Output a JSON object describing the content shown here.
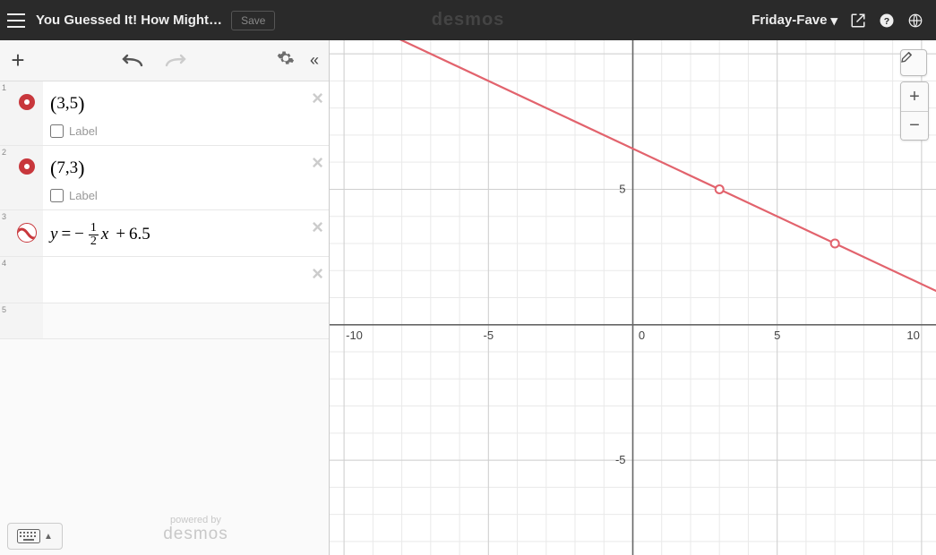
{
  "header": {
    "title": "You Guessed It! How Might…",
    "save_label": "Save",
    "brand": "desmos",
    "user": "Friday-Fave"
  },
  "toolbar": {
    "add_label": "+",
    "collapse_label": "«"
  },
  "expressions": [
    {
      "index": "1",
      "text": "(3,5)",
      "label_word": "Label",
      "type": "point"
    },
    {
      "index": "2",
      "text": "(7,3)",
      "label_word": "Label",
      "type": "point"
    },
    {
      "index": "3",
      "text": "y = − ½ x + 6.5",
      "frac_n": "1",
      "frac_d": "2",
      "const": "6.5",
      "type": "line"
    },
    {
      "index": "4",
      "text": ""
    },
    {
      "index": "5",
      "text": ""
    }
  ],
  "footer": {
    "powered_top": "powered by",
    "powered_brand": "desmos"
  },
  "graph_ticks": {
    "xneg10": "-10",
    "xneg5": "-5",
    "zero": "0",
    "x5": "5",
    "x10": "10",
    "y5": "5",
    "yneg5": "-5"
  },
  "chart_data": {
    "type": "line",
    "title": "",
    "xlabel": "",
    "ylabel": "",
    "xlim": [
      -10.5,
      10.5
    ],
    "ylim": [
      -8.5,
      10.5
    ],
    "series": [
      {
        "name": "y = -1/2 x + 6.5",
        "slope": -0.5,
        "intercept": 6.5,
        "x": [
          -10,
          10
        ],
        "y": [
          11.5,
          1.5
        ],
        "color": "#e2636d"
      }
    ],
    "points": [
      {
        "name": "(3,5)",
        "x": 3,
        "y": 5,
        "color": "#e2636d"
      },
      {
        "name": "(7,3)",
        "x": 7,
        "y": 3,
        "color": "#e2636d"
      }
    ],
    "grid": true
  }
}
